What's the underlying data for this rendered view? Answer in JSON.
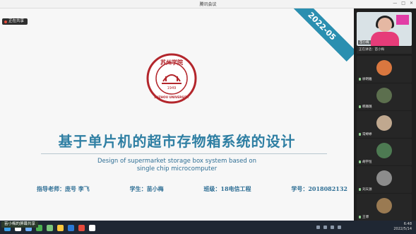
{
  "window": {
    "title": "腾讯会议"
  },
  "slide": {
    "badge": "正在共享",
    "ribbon": "2022-05",
    "emblem": {
      "top_text": "苏州学院",
      "year": "1949",
      "bottom_text": "SUZHOU UNIVERSITY"
    },
    "title_cn": "基于单片机的超市存物箱系统的设计",
    "title_en_line1": "Design of supermarket storage box system based on",
    "title_en_line2": "single chip microcomputer",
    "advisor": "指导老师：庞号  李飞",
    "student": "学生：苗小梅",
    "class": "班级：18电信工程",
    "student_id": "学号：2018082132"
  },
  "sidebar": {
    "main_name": "苗小梅",
    "speaking": "正在讲话：苗小梅",
    "participants": [
      {
        "name": "徐明雅",
        "color": "#d9773f"
      },
      {
        "name": "韩璐璐",
        "color": "#5c6f4e"
      },
      {
        "name": "常婷婷",
        "color": "#c0a88f"
      },
      {
        "name": "胡宇恒",
        "color": "#4d7a52"
      },
      {
        "name": "刘天源",
        "color": "#8c8c8c"
      },
      {
        "name": "王博",
        "color": "#9a7a52"
      }
    ]
  },
  "taskbar": {
    "share_label": "苗小梅的屏幕共享",
    "time": "6:48",
    "date": "2022/5/14",
    "icon_colors": [
      "#3aa0e8",
      "#ffffff",
      "#6fb0ff",
      "#4caf50",
      "#7bc67b",
      "#ffc83d",
      "#2b79d6",
      "#e64a3c",
      "#ffffff"
    ]
  }
}
